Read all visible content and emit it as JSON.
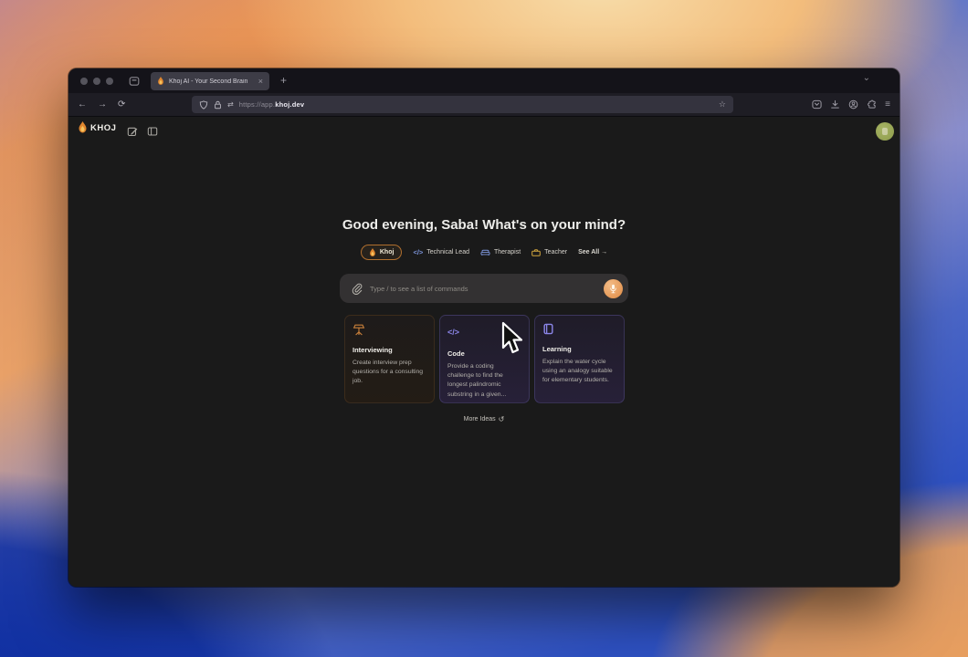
{
  "browser": {
    "tab_title": "Khoj AI - Your Second Brain",
    "url_prefix": "https://app.",
    "url_domain": "khoj.dev",
    "icons": {
      "back": "←",
      "forward": "→",
      "reload": "⟳",
      "new_tab": "+",
      "close_tab": "×",
      "tab_chevron": "⌄",
      "https_arrows": "⇄",
      "bookmark_star": "☆",
      "menu": "≡"
    }
  },
  "app": {
    "brand": "KHOJ",
    "greeting": "Good evening, Saba! What's on your mind?",
    "agents": [
      {
        "label": "Khoj",
        "icon": "khoj-flame-icon",
        "selected": true
      },
      {
        "label": "Technical Lead",
        "icon": "code-icon",
        "selected": false
      },
      {
        "label": "Therapist",
        "icon": "couch-icon",
        "selected": false
      },
      {
        "label": "Teacher",
        "icon": "briefcase-icon",
        "selected": false
      }
    ],
    "see_all_label": "See All →",
    "icons": {
      "code_glyph": "</>"
    },
    "input_placeholder": "Type / to see a list of commands",
    "suggestion_cards": [
      {
        "category": "Interviewing",
        "icon": "lectern-icon",
        "description": "Create interview prep questions for a consulting job."
      },
      {
        "category": "Code",
        "icon": "code-icon",
        "description": "Provide a coding challenge to find the longest palindromic substring in a given..."
      },
      {
        "category": "Learning",
        "icon": "book-icon",
        "description": "Explain the water cycle using an analogy suitable for elementary students."
      }
    ],
    "more_ideas_label": "More Ideas",
    "more_ideas_icon": "↺",
    "colors": {
      "accent_orange": "#d98e3f",
      "agent_blue": "#7d96dc",
      "agent_purple": "#8b85e8",
      "teacher_yellow": "#d2a63e",
      "avatar_green": "#9aa855"
    }
  }
}
